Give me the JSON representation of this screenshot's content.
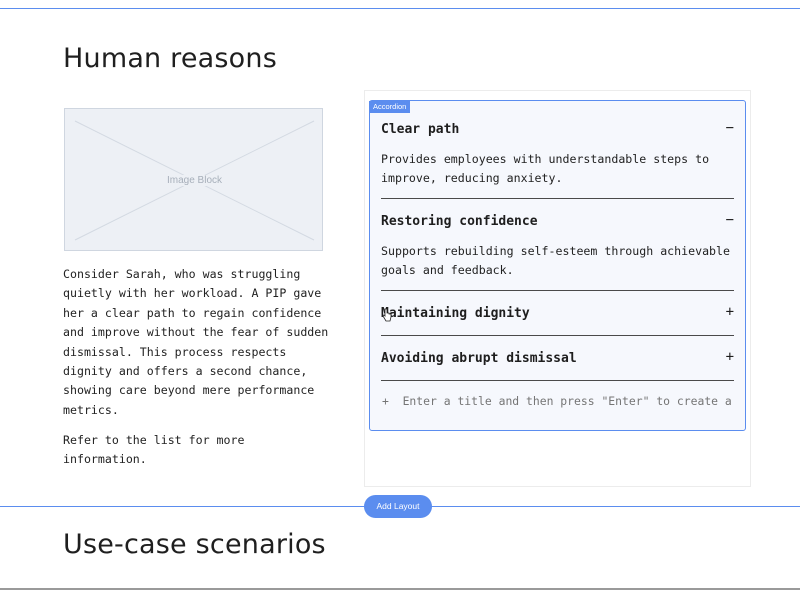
{
  "colors": {
    "accent": "#5b8def",
    "accordion_bg": "#f6f8fd",
    "image_placeholder": "#edf0f5"
  },
  "section1": {
    "title": "Human reasons",
    "image_block_label": "Image Block",
    "paragraph1": "Consider Sarah, who was struggling quietly with her workload. A PIP gave her a clear path to regain confidence and improve without the fear of sudden dismissal. This process respects dignity and offers a second chance, showing care beyond mere performance metrics.",
    "paragraph2": "Refer to the list for more information."
  },
  "accordion": {
    "tag": "Accordion",
    "items": [
      {
        "title": "Clear path",
        "toggle": "−",
        "expanded": true,
        "body": "Provides employees with understandable steps to improve, reducing anxiety."
      },
      {
        "title": "Restoring confidence",
        "toggle": "−",
        "expanded": true,
        "body": "Supports rebuilding self-esteem through achievable goals and feedback."
      },
      {
        "title": "Maintaining dignity",
        "toggle": "+",
        "expanded": false
      },
      {
        "title": "Avoiding abrupt dismissal",
        "toggle": "+",
        "expanded": false
      }
    ],
    "add_icon": "+",
    "add_placeholder": "Enter a title and then press \"Enter\" to create a"
  },
  "add_layout_label": "Add Layout",
  "section2": {
    "title": "Use-case scenarios"
  }
}
